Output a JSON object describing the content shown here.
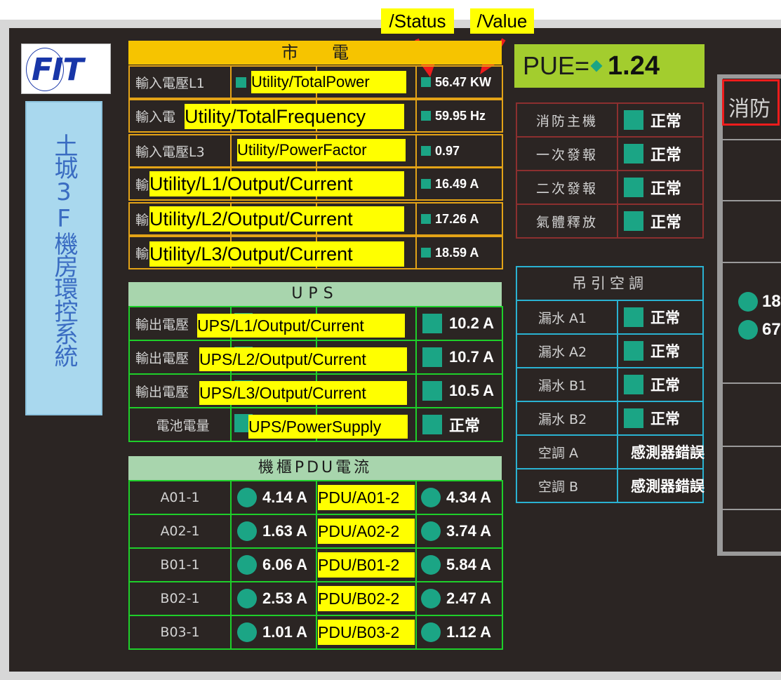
{
  "annotations": {
    "status_label": "/Status",
    "value_label": "/Value"
  },
  "system": {
    "title": "土城3F機房環控系統",
    "logo_text": "FIT"
  },
  "utility": {
    "header": "市　　電",
    "rows": [
      {
        "label": "輸入電壓L1",
        "tag": "Utility/TotalPower",
        "value": "56.47 KW"
      },
      {
        "label": "輸入電",
        "tag": "Utility/TotalFrequency",
        "value": "59.95 Hz"
      },
      {
        "label": "輸入電壓L3",
        "tag": "Utility/PowerFactor",
        "value": "0.97"
      },
      {
        "label": "輸",
        "tag": "Utility/L1/Output/Current",
        "value": "16.49 A"
      },
      {
        "label": "輸",
        "tag": "Utility/L2/Output/Current",
        "value": "17.26 A"
      },
      {
        "label": "輸",
        "tag": "Utility/L3/Output/Current",
        "value": "18.59 A"
      }
    ]
  },
  "pue": {
    "label": "PUE=",
    "value": "1.24"
  },
  "fire": {
    "rows": [
      {
        "label": "消防主機",
        "status": "正常"
      },
      {
        "label": "一次發報",
        "status": "正常"
      },
      {
        "label": "二次發報",
        "status": "正常"
      },
      {
        "label": "氣體釋放",
        "status": "正常"
      }
    ],
    "side_label": "消防"
  },
  "ups": {
    "header": "UPS",
    "rows": [
      {
        "label": "輸出電壓",
        "tag": "UPS/L1/Output/Current",
        "value": "10.2 A"
      },
      {
        "label": "輸出電壓",
        "tag": "UPS/L2/Output/Current",
        "value": "10.7 A"
      },
      {
        "label": "輸出電壓",
        "tag": "UPS/L3/Output/Current",
        "value": "10.5 A"
      },
      {
        "label": "電池電量",
        "tag": "UPS/PowerSupply",
        "value": "正常"
      }
    ]
  },
  "aircon": {
    "header": "吊引空調",
    "rows": [
      {
        "label": "漏水 A1",
        "status": "正常",
        "status_color": "#1ba585"
      },
      {
        "label": "漏水 A2",
        "status": "正常",
        "status_color": "#1ba585"
      },
      {
        "label": "漏水 B1",
        "status": "正常",
        "status_color": "#1ba585"
      },
      {
        "label": "漏水 B2",
        "status": "正常",
        "status_color": "#1ba585"
      },
      {
        "label": "空調 A",
        "status": "感測器錯誤",
        "status_color": "#e25450"
      },
      {
        "label": "空調 B",
        "status": "感測器錯誤",
        "status_color": "#e25450"
      }
    ]
  },
  "pdu": {
    "header": "機櫃PDU電流",
    "rows": [
      {
        "label": "A01-1",
        "value1": "4.14 A",
        "tag": "PDU/A01-2",
        "value2": "4.34 A"
      },
      {
        "label": "A02-1",
        "value1": "1.63 A",
        "tag": "PDU/A02-2",
        "value2": "3.74 A"
      },
      {
        "label": "B01-1",
        "value1": "6.06 A",
        "tag": "PDU/B01-2",
        "value2": "5.84 A"
      },
      {
        "label": "B02-1",
        "value1": "2.53 A",
        "tag": "PDU/B02-2",
        "value2": "2.47 A"
      },
      {
        "label": "B03-1",
        "value1": "1.01 A",
        "tag": "PDU/B03-2",
        "value2": "1.12 A"
      }
    ]
  },
  "right_partial": {
    "reading1": "18",
    "reading2": "67"
  }
}
